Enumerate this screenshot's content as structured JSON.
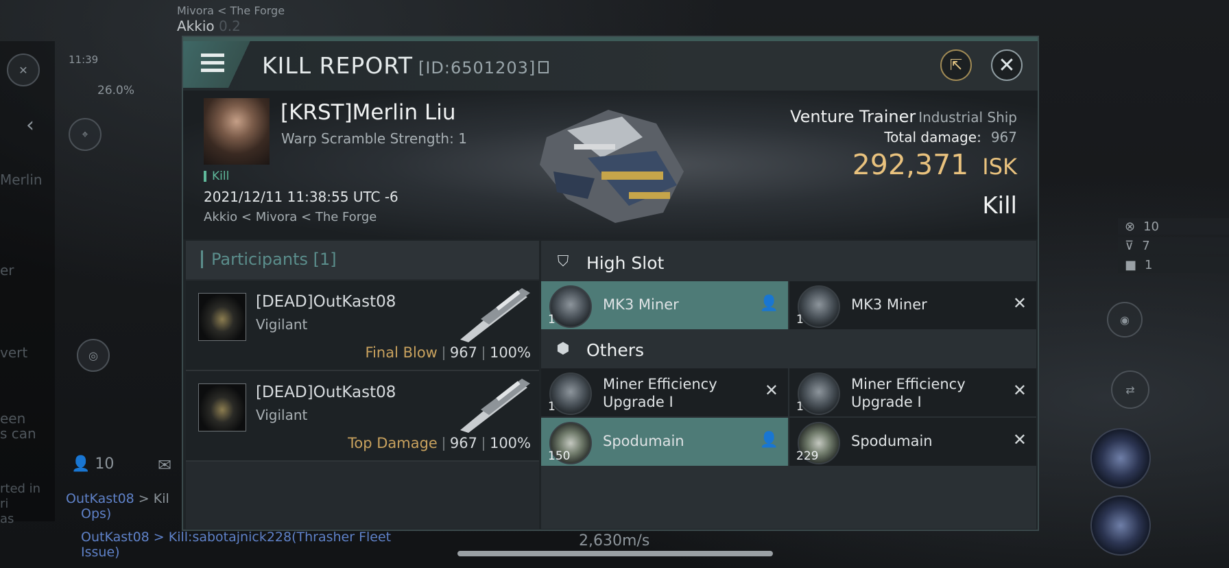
{
  "background": {
    "region": "Mivora",
    "region_parent": "< The Forge",
    "system": "Akkio",
    "security": "0.2",
    "time": "11:39",
    "cargo_pct": "26.0%",
    "side_labels": [
      "Merlin",
      "er",
      "vert",
      "een",
      "s can",
      "rted in",
      "ri",
      "as"
    ],
    "local_count": "10",
    "right_stats": [
      "10",
      "7",
      "1"
    ],
    "speed": "2,630m/s",
    "chat": [
      {
        "who": "OutKast08",
        "text": "> Kil",
        "text2": "Ops)"
      },
      {
        "who": "OutKast08",
        "text": "> Kill:sabotajnick228(Thrasher Fleet",
        "text2": "Issue)"
      }
    ]
  },
  "report": {
    "title": "KILL REPORT",
    "id_text": "[ID:6501203]",
    "victim": {
      "name": "[KRST]Merlin Liu",
      "scramble": "Warp Scramble Strength: 1",
      "kill_tag": "Kill",
      "datetime": "2021/12/11 11:38:55 UTC -6",
      "location": "Akkio < Mivora < The Forge",
      "ship": "Venture Trainer",
      "ship_class": "Industrial Ship",
      "total_damage_label": "Total damage:",
      "total_damage": "967",
      "isk_value": "292,371",
      "isk_unit": "ISK",
      "result": "Kill"
    },
    "participants_label": "Participants [1]",
    "attackers": [
      {
        "name": "[DEAD]OutKast08",
        "ship": "Vigilant",
        "tag": "Final Blow",
        "damage": "967",
        "pct": "100%"
      },
      {
        "name": "[DEAD]OutKast08",
        "ship": "Vigilant",
        "tag": "Top Damage",
        "damage": "967",
        "pct": "100%"
      }
    ],
    "high_slot_label": "High Slot",
    "others_label": "Others",
    "high_slot": [
      {
        "name": "MK3 Miner",
        "qty": "1",
        "state": "dropped"
      },
      {
        "name": "MK3 Miner",
        "qty": "1",
        "state": "destroyed"
      }
    ],
    "others": [
      {
        "name": "Miner Efficiency Upgrade I",
        "qty": "1",
        "state": "destroyed"
      },
      {
        "name": "Miner Efficiency Upgrade I",
        "qty": "1",
        "state": "destroyed"
      },
      {
        "name": "Spodumain",
        "qty": "150",
        "state": "dropped"
      },
      {
        "name": "Spodumain",
        "qty": "229",
        "state": "destroyed"
      }
    ]
  }
}
